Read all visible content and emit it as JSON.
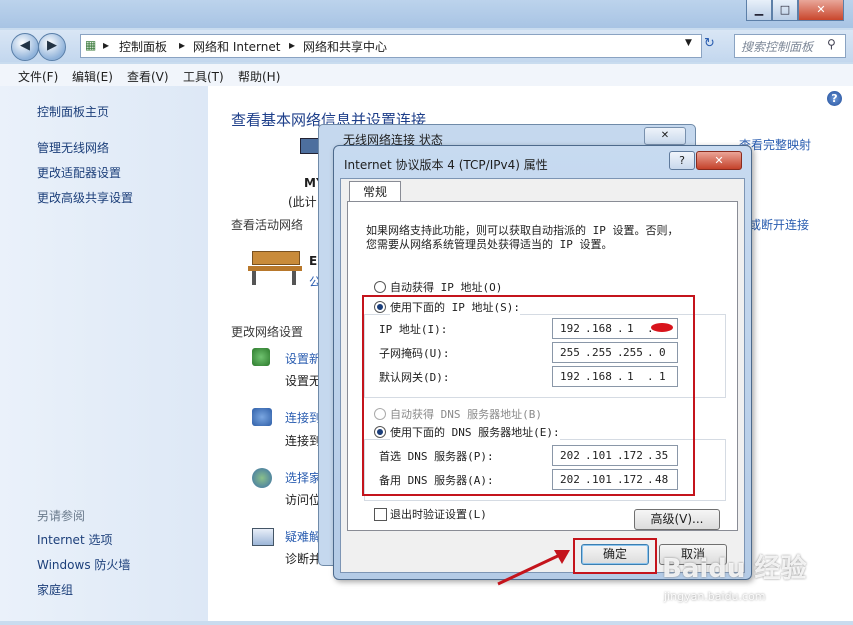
{
  "explorer": {
    "breadcrumb": [
      "控制面板",
      "网络和 Internet",
      "网络和共享中心"
    ],
    "search_placeholder": "搜索控制面板",
    "menu": [
      "文件(F)",
      "编辑(E)",
      "查看(V)",
      "工具(T)",
      "帮助(H)"
    ],
    "sidebar": {
      "home": "控制面板主页",
      "links": [
        "管理无线网络",
        "更改适配器设置",
        "更改高级共享设置"
      ],
      "see_also_title": "另请参阅",
      "see_also": [
        "Internet 选项",
        "Windows 防火墙",
        "家庭组"
      ]
    },
    "content": {
      "heading": "查看基本网络信息并设置连接",
      "full_map": "查看完整映射",
      "computer_short": "MY",
      "computer_sub": "(此计",
      "active_networks": "查看活动网络",
      "network_initial": "E",
      "network_sub": "公",
      "disconnect": "或断开连接",
      "change_settings": "更改网络设置",
      "tasks": [
        {
          "link": "设置新",
          "desc": "设置无"
        },
        {
          "link": "连接到",
          "desc": "连接到"
        },
        {
          "link": "选择家",
          "desc": "访问位"
        },
        {
          "link": "疑难解",
          "desc": "诊断并修"
        }
      ]
    }
  },
  "back_dialog": {
    "title": "无线网络连接 状态"
  },
  "dialog": {
    "title": "Internet 协议版本 4 (TCP/IPv4) 属性",
    "help_btn": "?",
    "close_btn": "✕",
    "tab": "常规",
    "description_line1": "如果网络支持此功能，则可以获取自动指派的 IP 设置。否则，",
    "description_line2": "您需要从网络系统管理员处获得适当的 IP 设置。",
    "auto_ip": "自动获得 IP 地址(O)",
    "manual_ip": "使用下面的 IP 地址(S):",
    "ip_label": "IP 地址(I):",
    "ip_value": [
      "192",
      "168",
      "1",
      ""
    ],
    "mask_label": "子网掩码(U):",
    "mask_value": [
      "255",
      "255",
      "255",
      "0"
    ],
    "gateway_label": "默认网关(D):",
    "gateway_value": [
      "192",
      "168",
      "1",
      "1"
    ],
    "auto_dns": "自动获得 DNS 服务器地址(B)",
    "manual_dns": "使用下面的 DNS 服务器地址(E):",
    "dns1_label": "首选 DNS 服务器(P):",
    "dns1_value": [
      "202",
      "101",
      "172",
      "35"
    ],
    "dns2_label": "备用 DNS 服务器(A):",
    "dns2_value": [
      "202",
      "101",
      "172",
      "48"
    ],
    "validate_checkbox": "退出时验证设置(L)",
    "advanced_btn": "高级(V)...",
    "ok_btn": "确定",
    "cancel_btn": "取消"
  },
  "watermark": {
    "brand": "Baidu 经验",
    "url": "jingyan.baidu.com"
  }
}
